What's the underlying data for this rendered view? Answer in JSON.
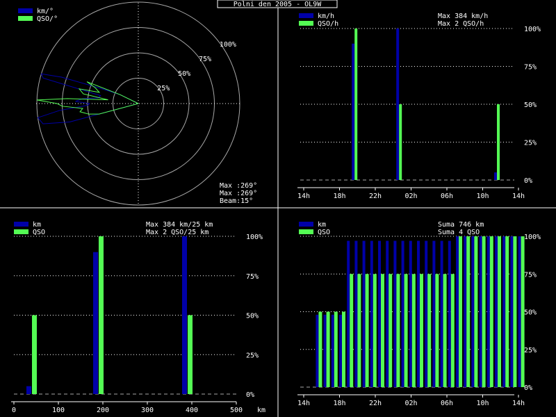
{
  "title": "Polni den 2005 - OL9W",
  "colors": {
    "blue": "#0000a8",
    "green": "#54fc54",
    "white": "#ffffff",
    "grid": "#a8a8a8",
    "bg": "#000000"
  },
  "chart_data": [
    {
      "type": "polar",
      "legend": [
        {
          "label": "km/°",
          "color": "#0000a8"
        },
        {
          "label": "QSO/°",
          "color": "#54fc54"
        }
      ],
      "ring_labels": [
        "25%",
        "50%",
        "75%",
        "100%"
      ],
      "info": {
        "km_max": "Max :269°",
        "qso_max": "Max :269°",
        "beam": "Beam:15°"
      },
      "series": [
        {
          "name": "km/°",
          "points": [
            [
              255,
              70
            ],
            [
              258,
              96
            ],
            [
              262,
              100
            ],
            [
              265,
              78
            ],
            [
              268,
              50
            ],
            [
              270,
              48
            ],
            [
              272,
              62
            ],
            [
              275,
              55
            ],
            [
              278,
              40
            ],
            [
              282,
              38
            ],
            [
              285,
              97
            ],
            [
              287,
              100
            ],
            [
              289,
              80
            ],
            [
              292,
              40
            ],
            [
              296,
              20
            ]
          ]
        },
        {
          "name": "QSO/°",
          "points": [
            [
              255,
              40
            ],
            [
              258,
              50
            ],
            [
              262,
              58
            ],
            [
              265,
              55
            ],
            [
              268,
              75
            ],
            [
              270,
              80
            ],
            [
              272,
              100
            ],
            [
              274,
              70
            ],
            [
              277,
              30
            ],
            [
              280,
              55
            ],
            [
              284,
              60
            ],
            [
              286,
              40
            ],
            [
              290,
              45
            ],
            [
              293,
              55
            ],
            [
              296,
              20
            ]
          ]
        }
      ]
    },
    {
      "type": "bar",
      "legend": [
        {
          "label": "km/h",
          "color": "#0000a8"
        },
        {
          "label": "QSO/h",
          "color": "#54fc54"
        }
      ],
      "stats": [
        "Max    384 km/h",
        "Max     2 QSO/h"
      ],
      "x_ticks": [
        "14h",
        "18h",
        "22h",
        "02h",
        "06h",
        "10h",
        "14h"
      ],
      "y_ticks": [
        "0%",
        "25%",
        "50%",
        "75%",
        "100%"
      ],
      "ylim": [
        0,
        100
      ],
      "n_slots": 24,
      "series": [
        {
          "name": "km/h",
          "values": [
            0,
            0,
            0,
            0,
            90,
            0,
            0,
            0,
            0,
            100,
            0,
            0,
            0,
            0,
            0,
            0,
            0,
            0,
            0,
            0,
            5,
            0,
            0,
            0
          ]
        },
        {
          "name": "QSO/h",
          "values": [
            0,
            0,
            0,
            0,
            100,
            0,
            0,
            0,
            0,
            50,
            0,
            0,
            0,
            0,
            0,
            0,
            0,
            0,
            0,
            0,
            50,
            0,
            0,
            0
          ]
        }
      ]
    },
    {
      "type": "bar",
      "legend": [
        {
          "label": "km",
          "color": "#0000a8"
        },
        {
          "label": "QSO",
          "color": "#54fc54"
        }
      ],
      "stats": [
        "Max    384 km/25 km",
        "Max     2 QSO/25 km"
      ],
      "x_ticks": [
        "0",
        "100",
        "200",
        "300",
        "400",
        "500"
      ],
      "x_unit": "km",
      "y_ticks": [
        "0%",
        "25%",
        "50%",
        "75%",
        "100%"
      ],
      "ylim": [
        0,
        100
      ],
      "xlim": [
        0,
        500
      ],
      "bin_width": 25,
      "series": [
        {
          "name": "km",
          "bins": [
            25,
            175,
            375
          ],
          "values": [
            5,
            90,
            100
          ]
        },
        {
          "name": "QSO",
          "bins": [
            25,
            175,
            375
          ],
          "values": [
            50,
            100,
            50
          ]
        }
      ]
    },
    {
      "type": "bar",
      "legend": [
        {
          "label": "km",
          "color": "#0000a8"
        },
        {
          "label": "QSO",
          "color": "#54fc54"
        }
      ],
      "stats": [
        "Suma    746 km",
        "Suma     4 QSO"
      ],
      "x_ticks": [
        "14h",
        "18h",
        "22h",
        "02h",
        "06h",
        "10h",
        "14h"
      ],
      "y_ticks": [
        "0%",
        "25%",
        "50%",
        "75%",
        "100%"
      ],
      "ylim": [
        0,
        100
      ],
      "n_slots": 24,
      "series": [
        {
          "name": "km",
          "values": [
            0,
            0,
            48,
            48,
            48,
            48,
            97,
            97,
            97,
            97,
            97,
            97,
            97,
            97,
            97,
            97,
            97,
            97,
            97,
            97,
            100,
            100,
            100,
            100,
            100,
            100,
            100,
            100,
            100
          ]
        },
        {
          "name": "QSO",
          "values": [
            0,
            0,
            50,
            50,
            50,
            50,
            75,
            75,
            75,
            75,
            75,
            75,
            75,
            75,
            75,
            75,
            75,
            75,
            75,
            75,
            100,
            100,
            100,
            100,
            100,
            100,
            100,
            100,
            100
          ]
        }
      ]
    }
  ]
}
